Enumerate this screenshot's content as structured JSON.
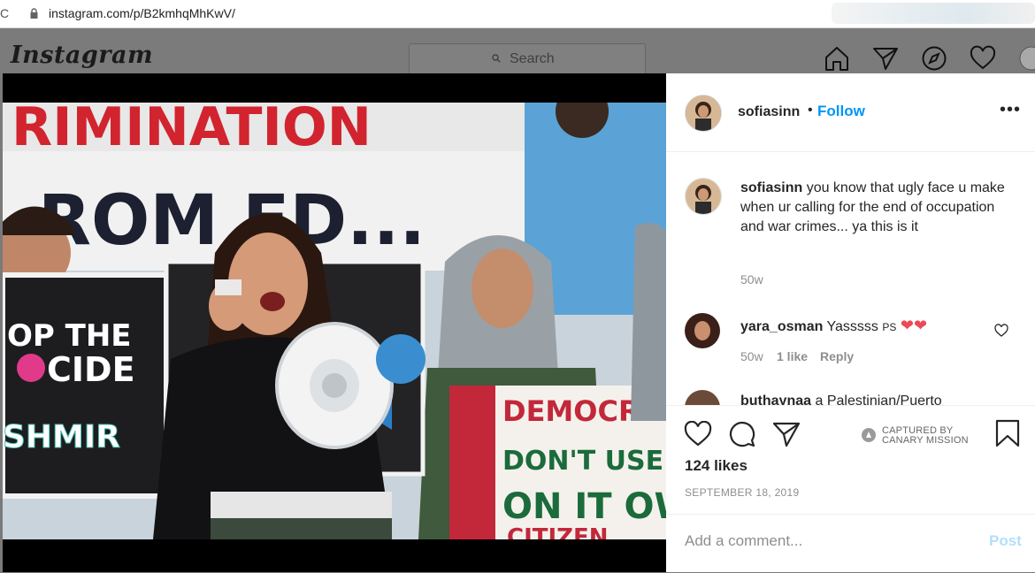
{
  "browser": {
    "url": "instagram.com/p/B2kmhqMhKwV/"
  },
  "header": {
    "logo": "Instagram",
    "search_placeholder": "Search",
    "nav_icons": [
      "home-icon",
      "direct-icon",
      "explore-icon",
      "heart-icon",
      "profile-icon"
    ]
  },
  "post": {
    "photo": {
      "sign_left": [
        "OP THE",
        "CIDE",
        "SHMIR"
      ],
      "banner_top": "RIMINATION",
      "banner_mid": "ROM ED...",
      "sign_right": [
        "DEMOCRACI",
        "DON'T USE SOLDIE",
        "ON IT OW",
        "CITIZEN"
      ]
    },
    "author": {
      "username": "sofiasinn",
      "follow_label": "Follow",
      "separator": "•"
    },
    "caption": {
      "username": "sofiasinn",
      "text": "you know that ugly face u make when ur calling for the end of occupation and war crimes... ya this is it",
      "age": "50w"
    },
    "comments": [
      {
        "username": "yara_osman",
        "text": "Yasssss",
        "suffix": "PS",
        "emoji": "❤❤",
        "age": "50w",
        "likes": "1 like",
        "reply_label": "Reply"
      },
      {
        "username": "buthaynaa",
        "text": "a Palestinian/Puerto"
      }
    ],
    "likes": "124 likes",
    "date": "SEPTEMBER 18, 2019",
    "captured_by": [
      "CAPTURED BY",
      "CANARY MISSION"
    ],
    "add_comment_placeholder": "Add a comment...",
    "post_label": "Post"
  },
  "colors": {
    "follow": "#0095f6",
    "heart": "#ed4956",
    "muted": "#8e8e8e"
  }
}
